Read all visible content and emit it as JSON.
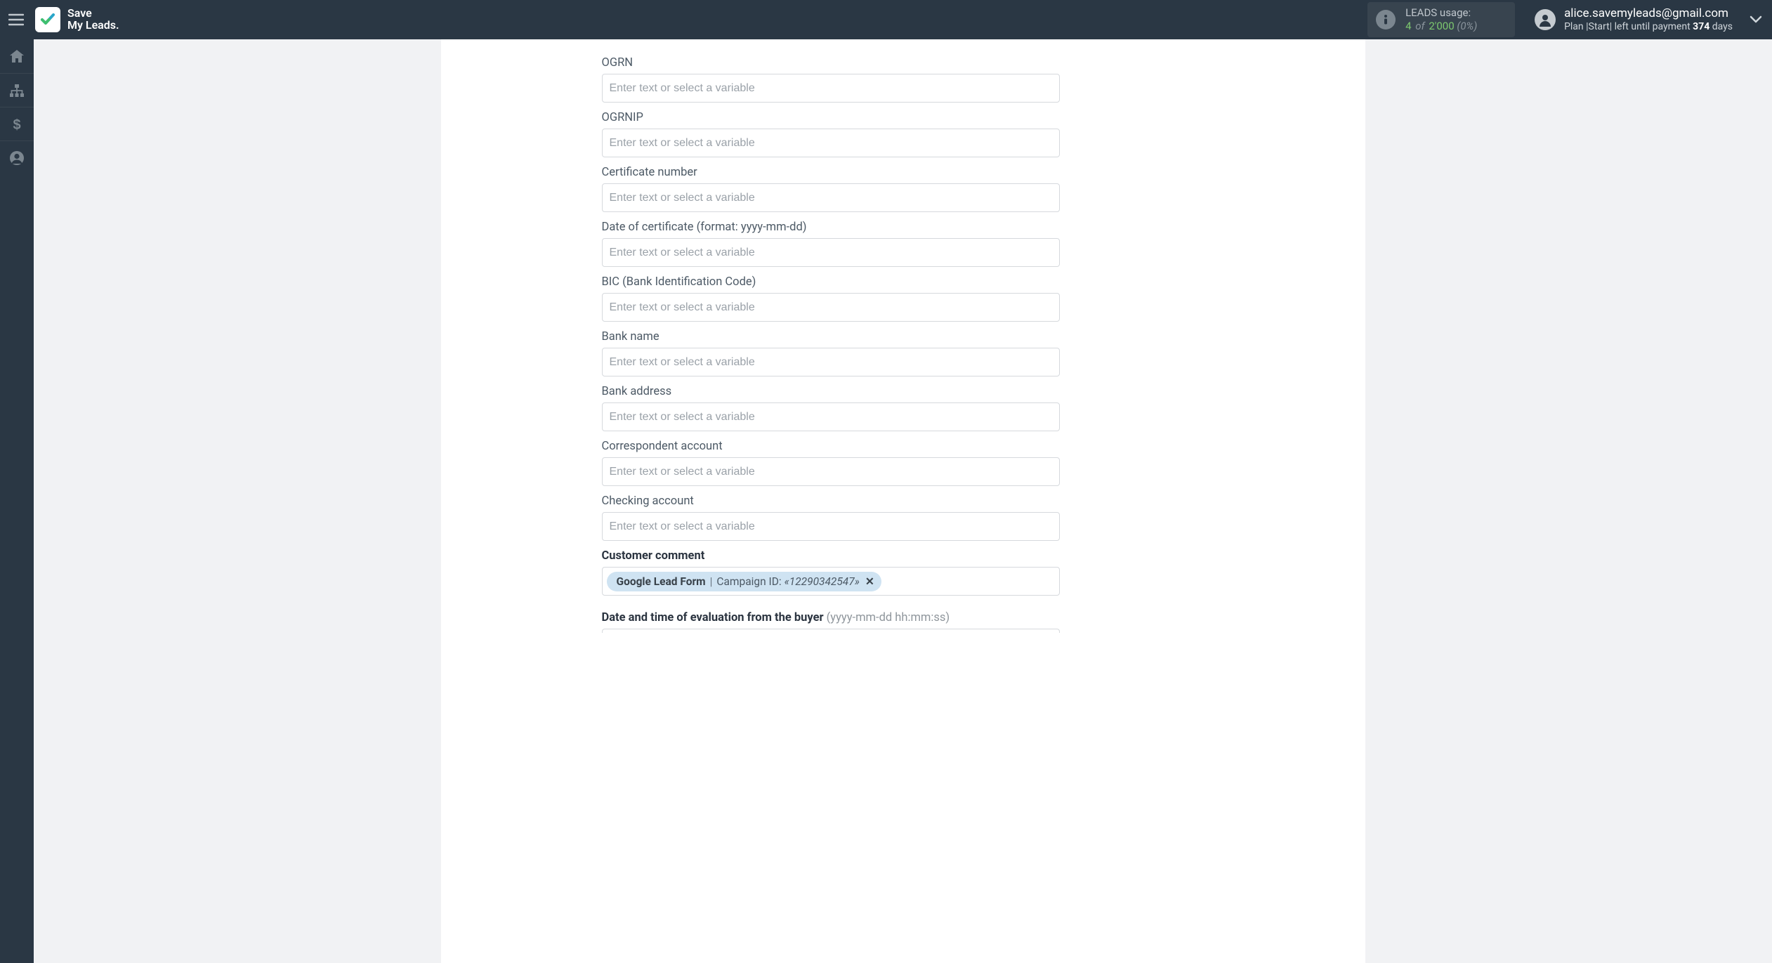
{
  "header": {
    "brand_line1": "Save",
    "brand_line2": "My Leads.",
    "leads": {
      "label": "LEADS usage:",
      "count": "4",
      "of": "of",
      "total": "2'000",
      "pct": "(0%)"
    },
    "account": {
      "email": "alice.savemyleads@gmail.com",
      "plan_prefix": "Plan |Start| left until payment ",
      "days": "374",
      "plan_suffix": " days"
    }
  },
  "rail": [
    {
      "name": "nav-home",
      "icon": "home"
    },
    {
      "name": "nav-connections",
      "icon": "sitemap"
    },
    {
      "name": "nav-billing",
      "icon": "dollar"
    },
    {
      "name": "nav-account",
      "icon": "user"
    }
  ],
  "fields": [
    {
      "key": "ogrn",
      "label": "OGRN",
      "placeholder": "Enter text or select a variable"
    },
    {
      "key": "ogrnip",
      "label": "OGRNIP",
      "placeholder": "Enter text or select a variable"
    },
    {
      "key": "cert_num",
      "label": "Certificate number",
      "placeholder": "Enter text or select a variable"
    },
    {
      "key": "cert_date",
      "label": "Date of certificate (format: yyyy-mm-dd)",
      "placeholder": "Enter text or select a variable"
    },
    {
      "key": "bic",
      "label": "BIC (Bank Identification Code)",
      "placeholder": "Enter text or select a variable"
    },
    {
      "key": "bank_name",
      "label": "Bank name",
      "placeholder": "Enter text or select a variable"
    },
    {
      "key": "bank_addr",
      "label": "Bank address",
      "placeholder": "Enter text or select a variable"
    },
    {
      "key": "corr_acct",
      "label": "Correspondent account",
      "placeholder": "Enter text or select a variable"
    },
    {
      "key": "check_acct",
      "label": "Checking account",
      "placeholder": "Enter text or select a variable"
    }
  ],
  "comment": {
    "label": "Customer comment",
    "chip": {
      "source": "Google Lead Form",
      "field_label": "Campaign ID:",
      "value": "«12290342547»"
    }
  },
  "eval": {
    "label": "Date and time of evaluation from the buyer",
    "hint": "(yyyy-mm-dd hh:mm:ss)"
  }
}
